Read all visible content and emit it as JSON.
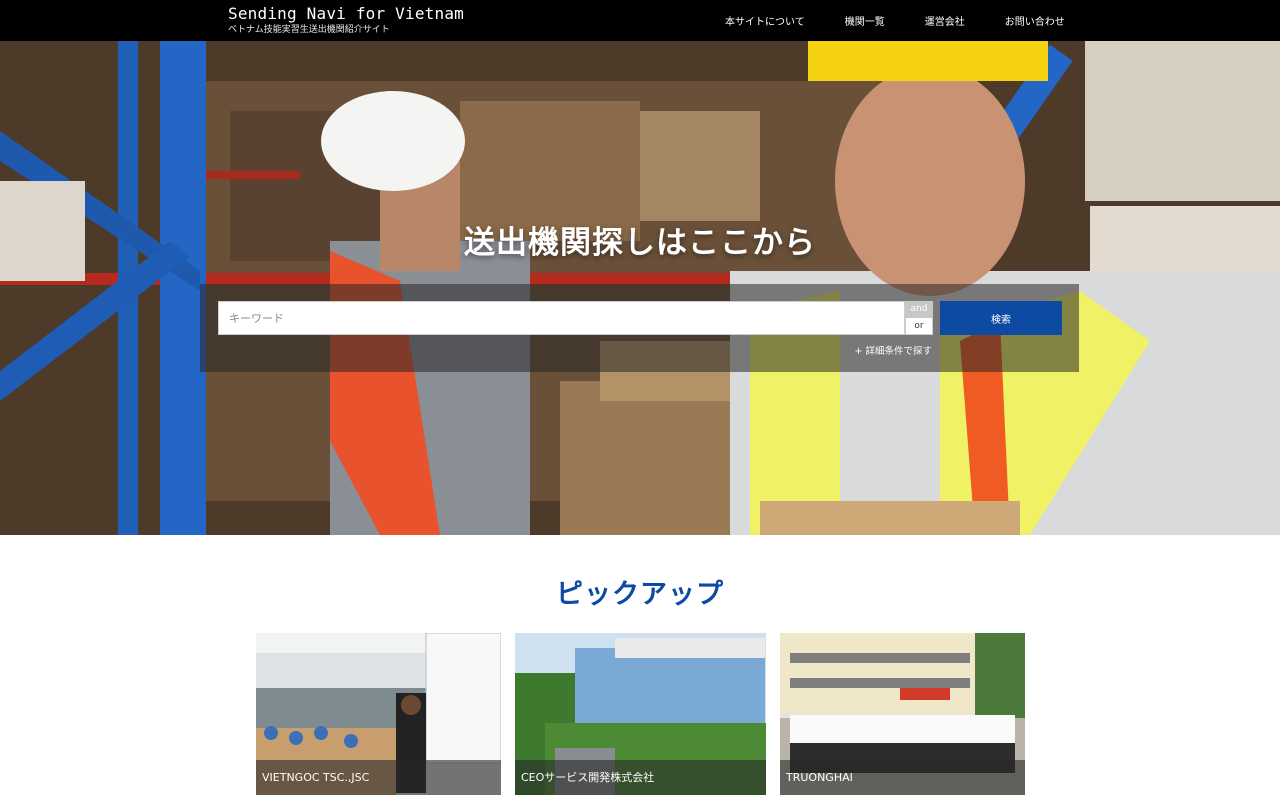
{
  "header": {
    "title": "Sending Navi for Vietnam",
    "subtitle": "ベトナム技能実習生送出機関紹介サイト",
    "nav": [
      {
        "label": "本サイトについて"
      },
      {
        "label": "機関一覧"
      },
      {
        "label": "運営会社"
      },
      {
        "label": "お問い合わせ"
      }
    ]
  },
  "hero": {
    "title": "送出機関探しはここから",
    "search_placeholder": "キーワード",
    "toggle_and": "and",
    "toggle_or": "or",
    "search_button": "検索",
    "advanced_link": "+ 詳細条件で探す"
  },
  "pickup": {
    "title": "ピックアップ",
    "cards": [
      {
        "label": "VIETNGOC TSC.,JSC"
      },
      {
        "label": "CEOサービス開発株式会社"
      },
      {
        "label": "TRUONGHAI"
      }
    ]
  },
  "colors": {
    "header_bg": "#000000",
    "accent": "#0d4aa3"
  }
}
